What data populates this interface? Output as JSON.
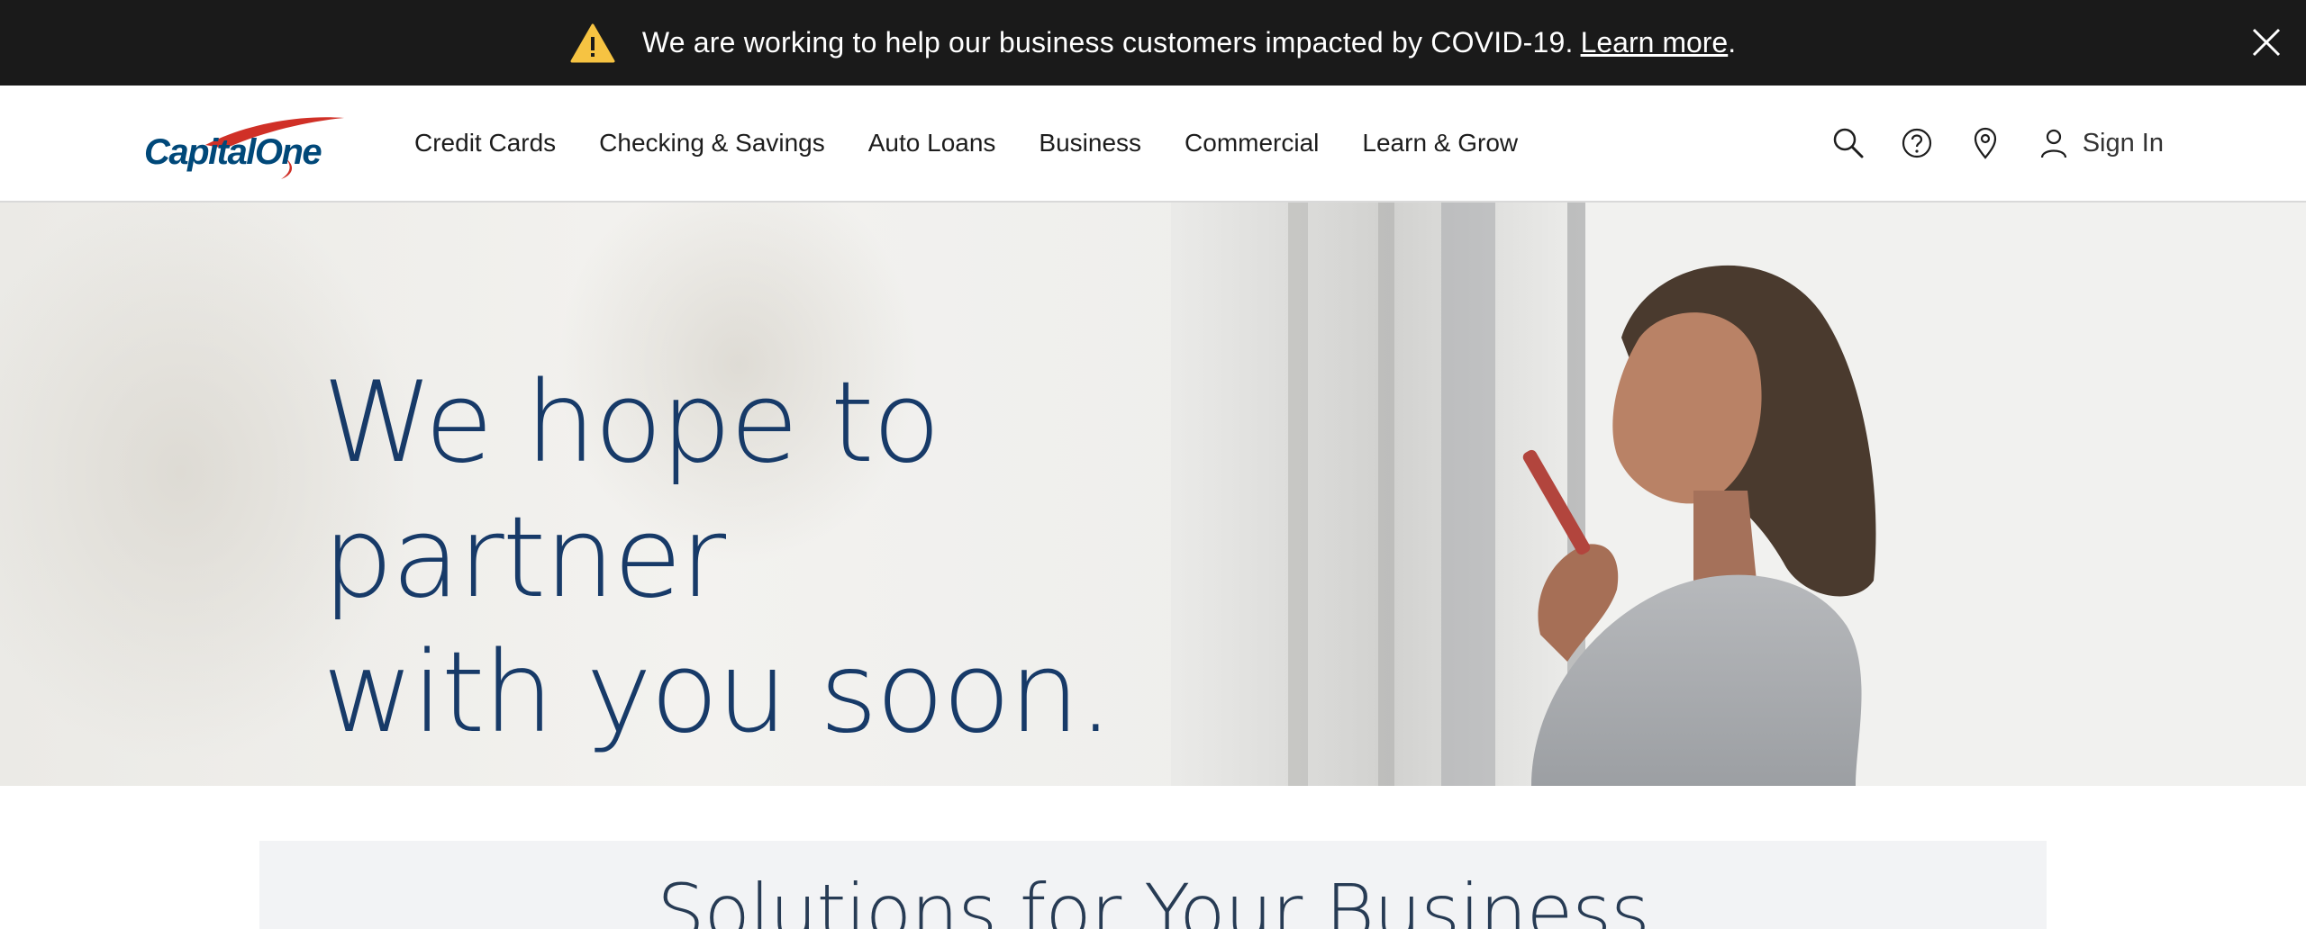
{
  "alert": {
    "message": "We are working to help our business customers impacted by COVID-19.",
    "link_label": "Learn more",
    "trailing": ".",
    "icon": "warning-icon",
    "close_icon": "close-icon"
  },
  "header": {
    "logo_text": "CapitalOne",
    "nav": [
      {
        "label": "Credit Cards"
      },
      {
        "label": "Checking & Savings"
      },
      {
        "label": "Auto Loans"
      },
      {
        "label": "Business"
      },
      {
        "label": "Commercial"
      },
      {
        "label": "Learn & Grow"
      }
    ],
    "utilities": [
      "search-icon",
      "help-icon",
      "location-pin-icon",
      "user-icon"
    ],
    "sign_in_label": "Sign In"
  },
  "hero": {
    "headline": "We hope to partner\nwith you soon."
  },
  "solutions": {
    "title": "Solutions for Your Business"
  },
  "colors": {
    "alert_bg": "#1a1a1a",
    "warning_yellow": "#f6c342",
    "brand_blue": "#004879",
    "brand_red": "#d03027",
    "headline_blue": "#173a68"
  }
}
